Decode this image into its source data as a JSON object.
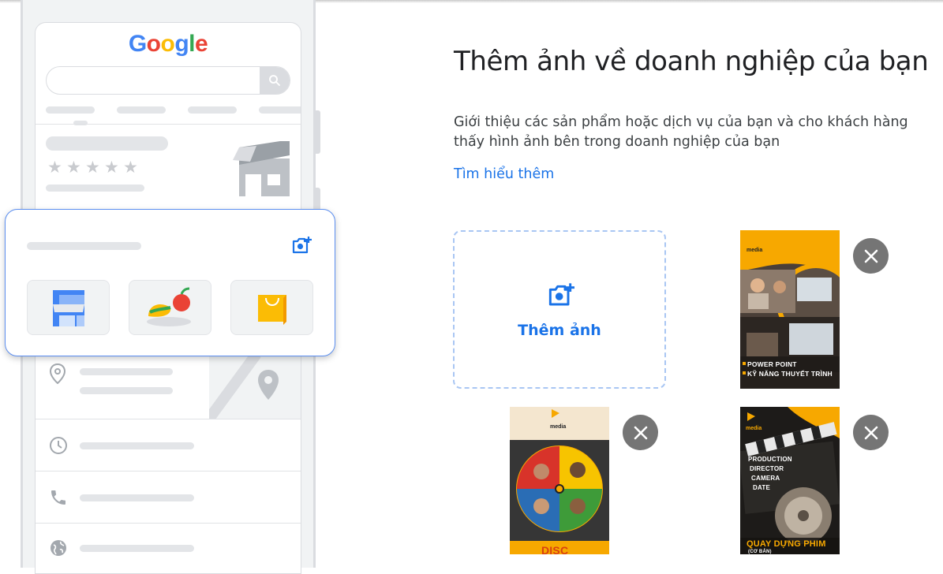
{
  "illustration": {
    "logo_letters": [
      {
        "ch": "G",
        "color": "#4285F4"
      },
      {
        "ch": "o",
        "color": "#EA4335"
      },
      {
        "ch": "o",
        "color": "#FBBC05"
      },
      {
        "ch": "g",
        "color": "#4285F4"
      },
      {
        "ch": "l",
        "color": "#34A853"
      },
      {
        "ch": "e",
        "color": "#EA4335"
      }
    ],
    "icons": [
      "search-icon",
      "star-icon",
      "storefront-icon",
      "add-photo-icon",
      "location-pin-icon",
      "map-pin-icon",
      "clock-icon",
      "phone-icon",
      "globe-icon"
    ],
    "rating_stars": 5
  },
  "content": {
    "title": "Thêm ảnh về doanh nghiệp của bạn",
    "description": "Giới thiệu các sản phẩm hoặc dịch vụ của bạn và cho khách hàng thấy hình ảnh bên trong doanh nghiệp của bạn",
    "learn_more": "Tìm hiểu thêm",
    "add_photo_label": "Thêm ảnh",
    "accent": "#1a73e8"
  },
  "photos": [
    {
      "name": "power-point",
      "brand": "media",
      "captions": [
        "POWER POINT",
        "KỸ NĂNG THUYẾT TRÌNH"
      ],
      "accent": "#f7a800"
    },
    {
      "name": "disc",
      "brand": "media",
      "captions": [
        "DISC"
      ],
      "accent": "#f7a800"
    },
    {
      "name": "quay-dung-phim",
      "brand": "media",
      "captions": [
        "PRODUCTION",
        "DIRECTOR",
        "CAMERA",
        "DATE",
        "QUAY DỰNG PHIM",
        "(CƠ BẢN)"
      ],
      "accent": "#f7a800"
    }
  ]
}
